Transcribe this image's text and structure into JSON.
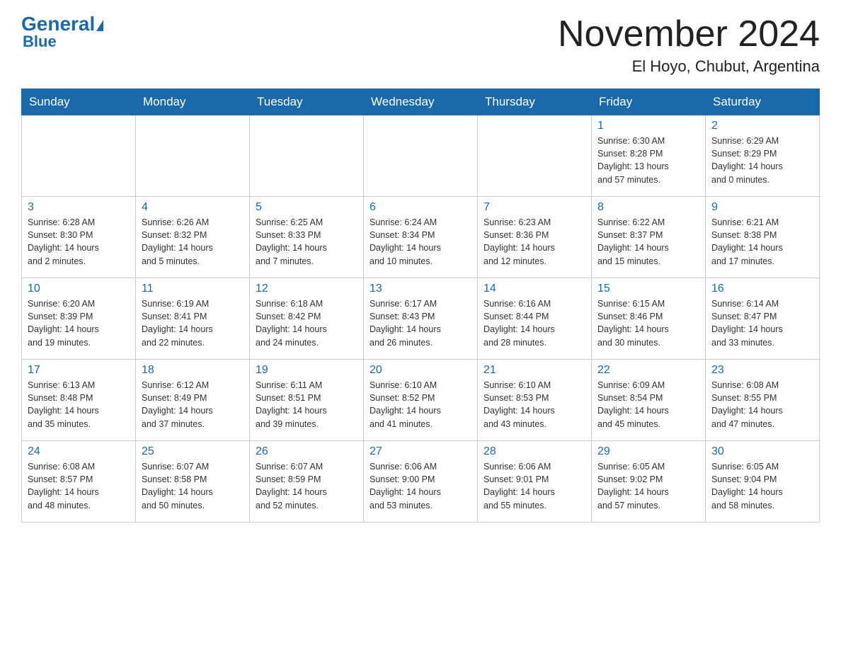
{
  "logo": {
    "top": "General",
    "bottom": "Blue"
  },
  "title": "November 2024",
  "subtitle": "El Hoyo, Chubut, Argentina",
  "days_of_week": [
    "Sunday",
    "Monday",
    "Tuesday",
    "Wednesday",
    "Thursday",
    "Friday",
    "Saturday"
  ],
  "weeks": [
    [
      {
        "day": "",
        "info": ""
      },
      {
        "day": "",
        "info": ""
      },
      {
        "day": "",
        "info": ""
      },
      {
        "day": "",
        "info": ""
      },
      {
        "day": "",
        "info": ""
      },
      {
        "day": "1",
        "info": "Sunrise: 6:30 AM\nSunset: 8:28 PM\nDaylight: 13 hours\nand 57 minutes."
      },
      {
        "day": "2",
        "info": "Sunrise: 6:29 AM\nSunset: 8:29 PM\nDaylight: 14 hours\nand 0 minutes."
      }
    ],
    [
      {
        "day": "3",
        "info": "Sunrise: 6:28 AM\nSunset: 8:30 PM\nDaylight: 14 hours\nand 2 minutes."
      },
      {
        "day": "4",
        "info": "Sunrise: 6:26 AM\nSunset: 8:32 PM\nDaylight: 14 hours\nand 5 minutes."
      },
      {
        "day": "5",
        "info": "Sunrise: 6:25 AM\nSunset: 8:33 PM\nDaylight: 14 hours\nand 7 minutes."
      },
      {
        "day": "6",
        "info": "Sunrise: 6:24 AM\nSunset: 8:34 PM\nDaylight: 14 hours\nand 10 minutes."
      },
      {
        "day": "7",
        "info": "Sunrise: 6:23 AM\nSunset: 8:36 PM\nDaylight: 14 hours\nand 12 minutes."
      },
      {
        "day": "8",
        "info": "Sunrise: 6:22 AM\nSunset: 8:37 PM\nDaylight: 14 hours\nand 15 minutes."
      },
      {
        "day": "9",
        "info": "Sunrise: 6:21 AM\nSunset: 8:38 PM\nDaylight: 14 hours\nand 17 minutes."
      }
    ],
    [
      {
        "day": "10",
        "info": "Sunrise: 6:20 AM\nSunset: 8:39 PM\nDaylight: 14 hours\nand 19 minutes."
      },
      {
        "day": "11",
        "info": "Sunrise: 6:19 AM\nSunset: 8:41 PM\nDaylight: 14 hours\nand 22 minutes."
      },
      {
        "day": "12",
        "info": "Sunrise: 6:18 AM\nSunset: 8:42 PM\nDaylight: 14 hours\nand 24 minutes."
      },
      {
        "day": "13",
        "info": "Sunrise: 6:17 AM\nSunset: 8:43 PM\nDaylight: 14 hours\nand 26 minutes."
      },
      {
        "day": "14",
        "info": "Sunrise: 6:16 AM\nSunset: 8:44 PM\nDaylight: 14 hours\nand 28 minutes."
      },
      {
        "day": "15",
        "info": "Sunrise: 6:15 AM\nSunset: 8:46 PM\nDaylight: 14 hours\nand 30 minutes."
      },
      {
        "day": "16",
        "info": "Sunrise: 6:14 AM\nSunset: 8:47 PM\nDaylight: 14 hours\nand 33 minutes."
      }
    ],
    [
      {
        "day": "17",
        "info": "Sunrise: 6:13 AM\nSunset: 8:48 PM\nDaylight: 14 hours\nand 35 minutes."
      },
      {
        "day": "18",
        "info": "Sunrise: 6:12 AM\nSunset: 8:49 PM\nDaylight: 14 hours\nand 37 minutes."
      },
      {
        "day": "19",
        "info": "Sunrise: 6:11 AM\nSunset: 8:51 PM\nDaylight: 14 hours\nand 39 minutes."
      },
      {
        "day": "20",
        "info": "Sunrise: 6:10 AM\nSunset: 8:52 PM\nDaylight: 14 hours\nand 41 minutes."
      },
      {
        "day": "21",
        "info": "Sunrise: 6:10 AM\nSunset: 8:53 PM\nDaylight: 14 hours\nand 43 minutes."
      },
      {
        "day": "22",
        "info": "Sunrise: 6:09 AM\nSunset: 8:54 PM\nDaylight: 14 hours\nand 45 minutes."
      },
      {
        "day": "23",
        "info": "Sunrise: 6:08 AM\nSunset: 8:55 PM\nDaylight: 14 hours\nand 47 minutes."
      }
    ],
    [
      {
        "day": "24",
        "info": "Sunrise: 6:08 AM\nSunset: 8:57 PM\nDaylight: 14 hours\nand 48 minutes."
      },
      {
        "day": "25",
        "info": "Sunrise: 6:07 AM\nSunset: 8:58 PM\nDaylight: 14 hours\nand 50 minutes."
      },
      {
        "day": "26",
        "info": "Sunrise: 6:07 AM\nSunset: 8:59 PM\nDaylight: 14 hours\nand 52 minutes."
      },
      {
        "day": "27",
        "info": "Sunrise: 6:06 AM\nSunset: 9:00 PM\nDaylight: 14 hours\nand 53 minutes."
      },
      {
        "day": "28",
        "info": "Sunrise: 6:06 AM\nSunset: 9:01 PM\nDaylight: 14 hours\nand 55 minutes."
      },
      {
        "day": "29",
        "info": "Sunrise: 6:05 AM\nSunset: 9:02 PM\nDaylight: 14 hours\nand 57 minutes."
      },
      {
        "day": "30",
        "info": "Sunrise: 6:05 AM\nSunset: 9:04 PM\nDaylight: 14 hours\nand 58 minutes."
      }
    ]
  ]
}
